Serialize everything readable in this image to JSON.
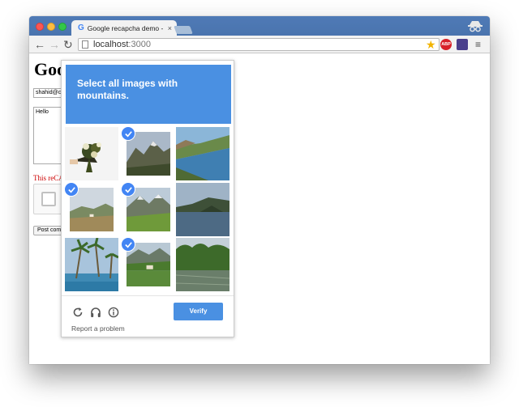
{
  "browser": {
    "tab_title": "Google recapcha demo - C",
    "tab_close": "×",
    "url_host": "localhost",
    "url_port": ":3000",
    "abp_label": "ABP"
  },
  "page": {
    "heading": "Goo",
    "email_value": "shahid@c",
    "textarea_value": "Hello",
    "warning_text": "This reCA",
    "post_button_label": "Post com"
  },
  "recaptcha": {
    "prompt": "Select all images with mountains.",
    "verify_label": "Verify",
    "report_label": "Report a problem",
    "tiles": [
      {
        "subject": "flower bouquet",
        "selected": false
      },
      {
        "subject": "mountain",
        "selected": true
      },
      {
        "subject": "river landscape",
        "selected": false
      },
      {
        "subject": "hills",
        "selected": true
      },
      {
        "subject": "mountain meadow",
        "selected": true
      },
      {
        "subject": "lake",
        "selected": false
      },
      {
        "subject": "palm trees beach",
        "selected": false
      },
      {
        "subject": "mountain lake",
        "selected": true
      },
      {
        "subject": "river trees",
        "selected": false
      }
    ]
  },
  "colors": {
    "accent": "#4a90e2",
    "check": "#4285f4",
    "titlebar": "#4a74ae",
    "warning": "#cc0000"
  }
}
